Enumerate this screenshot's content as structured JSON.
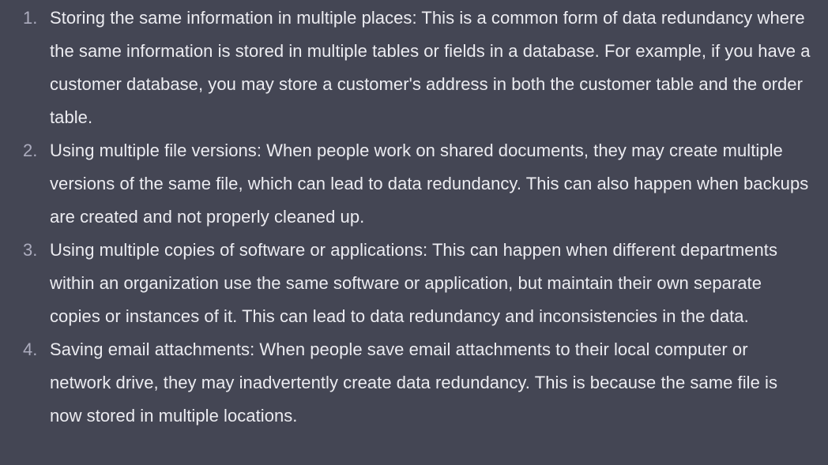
{
  "answer": {
    "items": [
      {
        "number": "1.",
        "text": "Storing the same information in multiple places: This is a common form of data redundancy where the same information is stored in multiple tables or fields in a database. For example, if you have a customer database, you may store a customer's address in both the customer table and the order table."
      },
      {
        "number": "2.",
        "text": "Using multiple file versions: When people work on shared documents, they may create multiple versions of the same file, which can lead to data redundancy. This can also happen when backups are created and not properly cleaned up."
      },
      {
        "number": "3.",
        "text": "Using multiple copies of software or applications: This can happen when different departments within an organization use the same software or application, but maintain their own separate copies or instances of it. This can lead to data redundancy and inconsistencies in the data."
      },
      {
        "number": "4.",
        "text": "Saving email attachments: When people save email attachments to their local computer or network drive, they may inadvertently create data redundancy. This is because the same file is now stored in multiple locations."
      }
    ]
  },
  "colors": {
    "background": "#444654",
    "text": "#ececf1",
    "number": "#acacbe"
  }
}
